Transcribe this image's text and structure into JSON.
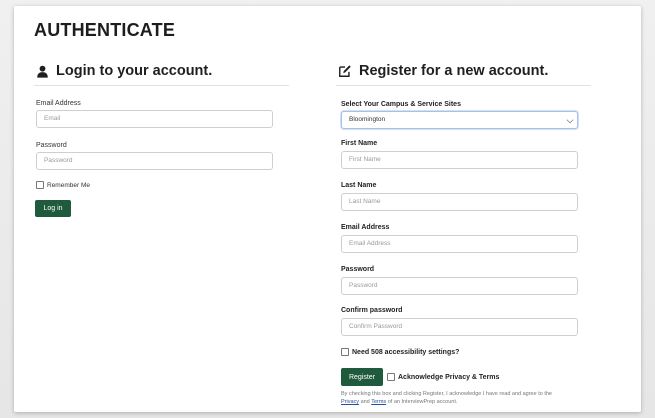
{
  "page": {
    "title": "AUTHENTICATE"
  },
  "login": {
    "heading": "Login to your account.",
    "email_label": "Email Address",
    "email_placeholder": "Email",
    "password_label": "Password",
    "password_placeholder": "Password",
    "remember_label": "Remember Me",
    "login_button": "Log in"
  },
  "register": {
    "heading": "Register for a new account.",
    "campus_label": "Select Your Campus & Service Sites",
    "campus_value": "Bloomington",
    "first_name_label": "First Name",
    "first_name_placeholder": "First Name",
    "last_name_label": "Last Name",
    "last_name_placeholder": "Last Name",
    "email_label": "Email Address",
    "email_placeholder": "Email Address",
    "password_label": "Password",
    "password_placeholder": "Password",
    "confirm_label": "Confirm password",
    "confirm_placeholder": "Confirm Password",
    "accessibility_label": "Need 508 accessibility settings?",
    "register_button": "Register",
    "acknowledge_label": "Acknowledge Privacy & Terms",
    "fine_print_1": "By checking this box and clicking Register, I acknowledge I have read and agree to the",
    "privacy_link": "Privacy",
    "fine_print_and": "and",
    "terms_link": "Terms",
    "fine_print_2": "of an InterviewPrep account."
  },
  "colors": {
    "accent": "#1f5a3c",
    "card": "#ffffff",
    "background": "#ececec"
  },
  "icons": {
    "login": "user-icon",
    "register": "edit-icon"
  }
}
